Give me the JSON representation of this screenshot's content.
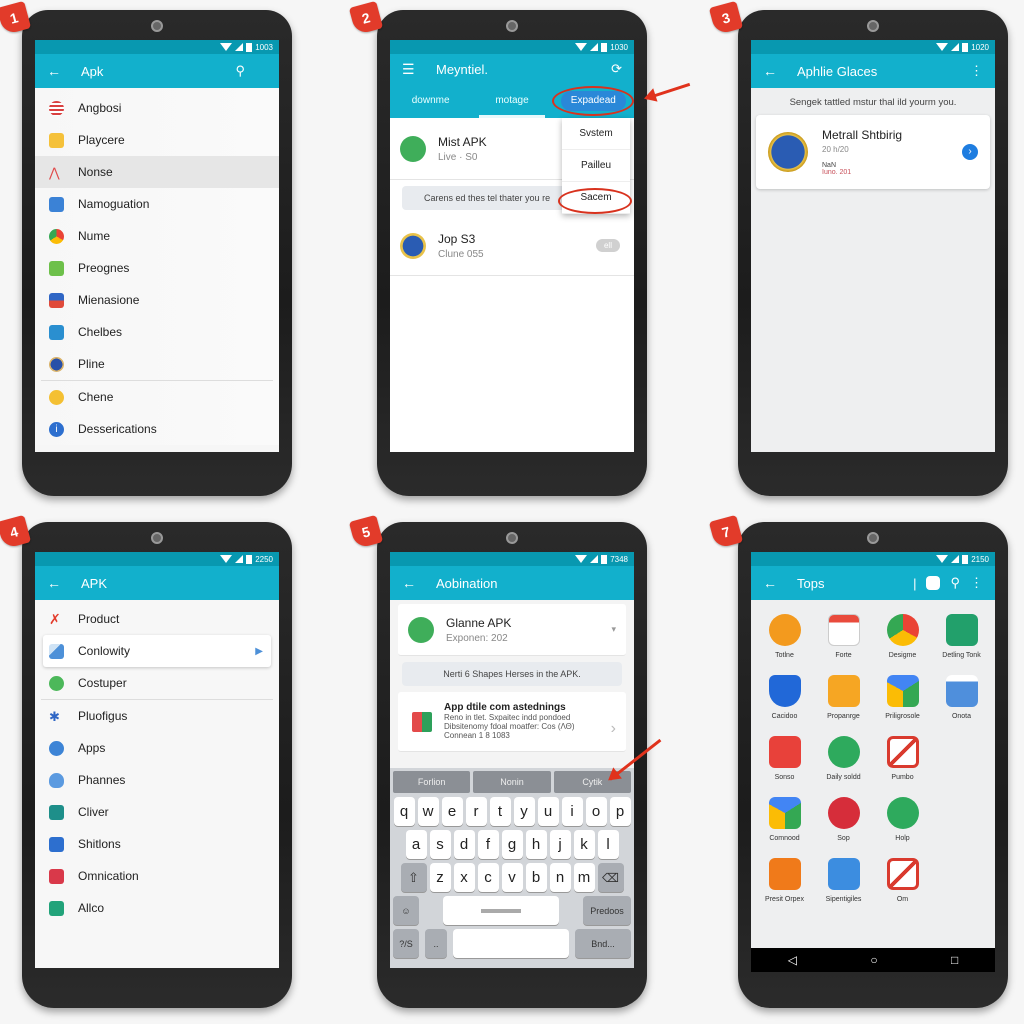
{
  "steps": [
    {
      "badge": "1",
      "status_time": "1003",
      "appbar": {
        "title": "Apk",
        "back_icon": "arrow-left",
        "action_icon": "search"
      },
      "items": [
        {
          "label": "Angbosi",
          "icon_color": "#d94040"
        },
        {
          "label": "Playcere",
          "icon_color": "#f5c13a"
        },
        {
          "label": "Nonse",
          "icon_color": "#e04a4a",
          "selected": true
        },
        {
          "label": "Namoguation",
          "icon_color": "#3b82d6"
        },
        {
          "label": "Nume",
          "icon_color": "#34a853"
        },
        {
          "label": "Preognes",
          "icon_color": "#6dc04a"
        },
        {
          "label": "Mienasione",
          "icon_color": "#2f66c5"
        },
        {
          "label": "Chelbes",
          "icon_color": "#2a8fd0"
        },
        {
          "label": "Pline",
          "icon_color": "#2850a8"
        },
        {
          "label": "Chene",
          "icon_color": "#f4c033"
        },
        {
          "label": "Desserications",
          "icon_color": "#2d6fcf"
        }
      ]
    },
    {
      "badge": "2",
      "status_time": "1030",
      "appbar": {
        "title": "Meyntiel.",
        "menu_icon": "hamburger",
        "action_icon": "refresh-search"
      },
      "tabs": [
        {
          "label": "downme"
        },
        {
          "label": "motage",
          "active": true
        },
        {
          "label": "Expadead",
          "highlighted": true
        }
      ],
      "rows": [
        {
          "title": "Mist APK",
          "subtitle": "Live · S0",
          "icon_color": "#3fae5a"
        },
        {
          "title": "Jop S3",
          "subtitle": "Clune 055",
          "icon_color": "#2a5cb3",
          "chip": "ell"
        }
      ],
      "note": "Carens ed thes tel thater you re",
      "dropdown": [
        "Svstem",
        "Pailleu",
        "Sacem"
      ],
      "annotated_item": "Sacem"
    },
    {
      "badge": "3",
      "status_time": "1020",
      "appbar": {
        "title": "Aphlie Glaces",
        "back_icon": "arrow-left",
        "action_icon": "more-vert"
      },
      "header_text": "Sengek tattled mstur thal ild yourm you.",
      "card": {
        "title": "Metrall Shtbirig",
        "subtitle": "20 h/20",
        "meta1": "NaN",
        "meta2": "Iuno. 201",
        "icon_color": "#2a5cb3",
        "accent": "#1e7de0"
      }
    },
    {
      "badge": "4",
      "status_time": "2250",
      "appbar": {
        "title": "APK",
        "back_icon": "arrow-left"
      },
      "items": [
        {
          "label": "Product",
          "icon_color": "#e33c2c"
        },
        {
          "label": "Conlowity",
          "icon_color": "#4d90d8",
          "selected": true
        },
        {
          "label": "Costuper",
          "icon_color": "#4cb85a"
        },
        {
          "label": "Pluofigus",
          "icon_color": "#2f66c5"
        },
        {
          "label": "Apps",
          "icon_color": "#3d84d6"
        },
        {
          "label": "Phannes",
          "icon_color": "#5b9ae0"
        },
        {
          "label": "Cliver",
          "icon_color": "#1e8f8a"
        },
        {
          "label": "Shitlons",
          "icon_color": "#2d6fcf"
        },
        {
          "label": "Omnication",
          "icon_color": "#d9394a"
        },
        {
          "label": "Allco",
          "icon_color": "#22a37a"
        }
      ]
    },
    {
      "badge": "5",
      "status_time": "7348",
      "appbar": {
        "title": "Aobination",
        "back_icon": "arrow-left"
      },
      "app_row": {
        "title": "Glanne APK",
        "subtitle": "Exponen: 202",
        "icon_color": "#3fae5a"
      },
      "note": "Nerti 6 Shapes Herses in the APK.",
      "detail": {
        "title": "App dtile com astednings",
        "line1": "Reno in tlet. Sxpaitec indd pondoed",
        "line2": "Dibsitenomy fdoal moatfer: Cos (ΛΘ)",
        "line3": "Connean 1 8 1083"
      },
      "suggestions": [
        "Forlion",
        "Nonin",
        "Cytik"
      ],
      "keyboard": {
        "row1": [
          "q",
          "w",
          "e",
          "r",
          "t",
          "y",
          "u",
          "i",
          "o",
          "p"
        ],
        "row2": [
          "a",
          "s",
          "d",
          "f",
          "g",
          "h",
          "j",
          "k",
          "l"
        ],
        "row3": [
          "z",
          "x",
          "c",
          "v",
          "b",
          "n",
          "m"
        ],
        "emoji_key": "☺",
        "predict_key": "Predoos",
        "mode_key": "?/S",
        "dots_key": "..",
        "enter_key": "Bnd..."
      }
    },
    {
      "badge": "7",
      "status_time": "2150",
      "appbar": {
        "title": "Tops",
        "back_icon": "arrow-left",
        "actions": [
          "pipe",
          "chat",
          "search",
          "more-vert"
        ]
      },
      "apps": [
        {
          "label": "Totlne",
          "color": "#f39a1e",
          "shape": "circle"
        },
        {
          "label": "Forte",
          "color": "#e94b3c",
          "shape": "calendar"
        },
        {
          "label": "Desigme",
          "color": "#4285f4",
          "shape": "chrome"
        },
        {
          "label": "Detling Tonk",
          "color": "#22a06b",
          "shape": "square"
        },
        {
          "label": "Cacidoo",
          "color": "#2168d8",
          "shape": "shield"
        },
        {
          "label": "Propanrge",
          "color": "#f6a623",
          "shape": "rounded"
        },
        {
          "label": "Priligrosole",
          "color": "#34a853",
          "shape": "drive"
        },
        {
          "label": "Onota",
          "color": "#4f8fdc",
          "shape": "doc"
        },
        {
          "label": "Sonso",
          "color": "#e8413a",
          "shape": "rounded"
        },
        {
          "label": "Daily soldd",
          "color": "#2eaa5d",
          "shape": "circle"
        },
        {
          "label": "Pumbo",
          "color": "#d93a2e",
          "shape": "gmail"
        },
        {
          "label": "",
          "color": "",
          "shape": "none"
        },
        {
          "label": "Comnood",
          "color": "#1fa463",
          "shape": "drive"
        },
        {
          "label": "Sop",
          "color": "#d62d3a",
          "shape": "circle"
        },
        {
          "label": "Holp",
          "color": "#2eaa5d",
          "shape": "circle"
        },
        {
          "label": "",
          "color": "",
          "shape": "none"
        },
        {
          "label": "Presit Orpex",
          "color": "#f07a1a",
          "shape": "square"
        },
        {
          "label": "Sipentigiles",
          "color": "#3c8de0",
          "shape": "rounded"
        },
        {
          "label": "Om",
          "color": "#d93a2e",
          "shape": "gmail"
        }
      ],
      "navbar": {
        "back": "◁",
        "home": "○",
        "recents": "□"
      }
    }
  ]
}
